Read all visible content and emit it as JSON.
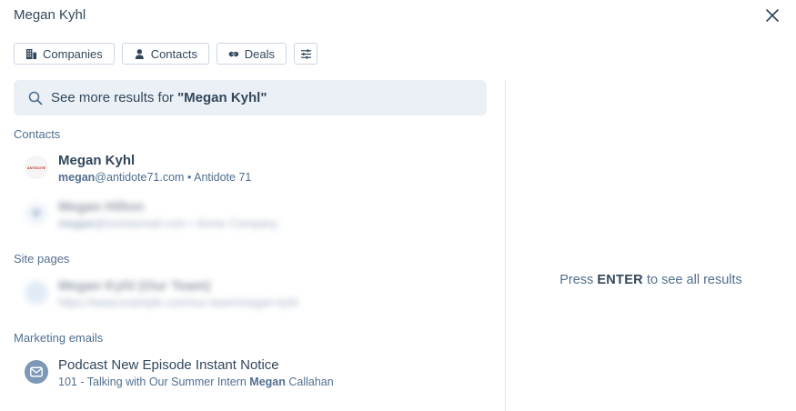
{
  "search": {
    "query": "Megan Kyhl"
  },
  "filters": [
    {
      "label": "Companies",
      "icon": "building-icon"
    },
    {
      "label": "Contacts",
      "icon": "person-icon"
    },
    {
      "label": "Deals",
      "icon": "handshake-icon"
    }
  ],
  "see_more": {
    "prefix": "See more results for",
    "query": "\"Megan Kyhl\""
  },
  "sections": {
    "contacts": "Contacts",
    "site_pages": "Site pages",
    "marketing_emails": "Marketing emails"
  },
  "contacts": [
    {
      "name": "Megan Kyhl",
      "email_bold": "megan",
      "email_rest": "@antidote71.com",
      "company": "Antidote 71",
      "avatar_text": "ANTIDOTE"
    },
    {
      "name": "Megan Hilton",
      "email_bold": "megan",
      "email_rest": "@someemail.com",
      "company": "Some Company",
      "blurred": true
    }
  ],
  "site_pages": [
    {
      "title": "Megan Kyhl (Our Team)",
      "url": "https://www.example.com/our-team/megan-kyhl",
      "blurred": true
    }
  ],
  "emails": [
    {
      "title": "Podcast New Episode Instant Notice",
      "sub_prefix": "101 - Talking with Our Summer Intern",
      "sub_bold": "Megan",
      "sub_suffix": "Callahan"
    }
  ],
  "hint": {
    "prefix": "Press",
    "key": "ENTER",
    "suffix": "to see all results"
  },
  "colors": {
    "see_more_bg": "#eaf0f6",
    "text": "#33475b",
    "muted": "#516f90"
  }
}
